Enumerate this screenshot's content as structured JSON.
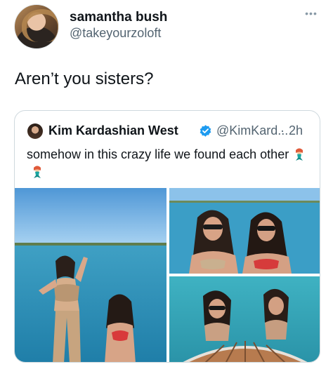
{
  "tweet": {
    "author_name": "samantha bush",
    "author_handle": "@takeyourzoloft",
    "text": "Aren’t you sisters?",
    "more_icon": "more-icon",
    "more_glyph": "•••"
  },
  "quote": {
    "author_name": "Kim Kardashian West",
    "author_handle": "@KimKard...",
    "separator": "·",
    "time": "2h",
    "text": "somehow in this crazy life we found each other",
    "verified_icon": "verified-icon",
    "emoji": [
      "mermaid-emoji",
      "mermaid-emoji"
    ],
    "photos": [
      "beach-photo",
      "boat-photo",
      "swimming-photo"
    ]
  },
  "colors": {
    "text": "#0f1419",
    "secondary": "#536471",
    "border": "#cfd9de",
    "verified": "#1d9bf0",
    "sky": "#6fb3e6",
    "sea": "#2f8fb8"
  }
}
